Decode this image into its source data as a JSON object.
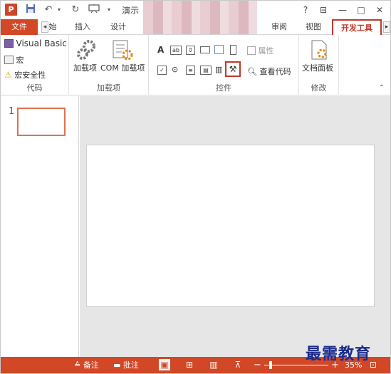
{
  "titlebar": {
    "app_logo": "P",
    "title": "演示",
    "help": "?",
    "ribbon_display": "⊟",
    "minimize": "—",
    "restore": "□",
    "close": "✕"
  },
  "tabs": {
    "file": "文件",
    "home_partial": "始",
    "insert": "插入",
    "design": "设计",
    "review": "审阅",
    "view": "视图",
    "developer": "开发工具"
  },
  "ribbon": {
    "code": {
      "label": "代码",
      "visual_basic": "Visual Basic",
      "macros": "宏",
      "macro_security": "宏安全性"
    },
    "addins": {
      "label": "加载项",
      "addins_btn": "加载项",
      "com_addins_btn": "COM 加载项"
    },
    "controls": {
      "label": "控件",
      "properties": "属性",
      "view_code": "查看代码"
    },
    "modify": {
      "label": "修改",
      "document_panel": "文档面板"
    }
  },
  "thumbnails": {
    "slide_number": "1"
  },
  "status": {
    "notes": "备注",
    "comments": "批注",
    "zoom": "35%",
    "zoom_fraction": 0.35
  },
  "watermark": "最需教育",
  "colors": {
    "accent": "#d24726",
    "highlight": "#c0392b"
  }
}
